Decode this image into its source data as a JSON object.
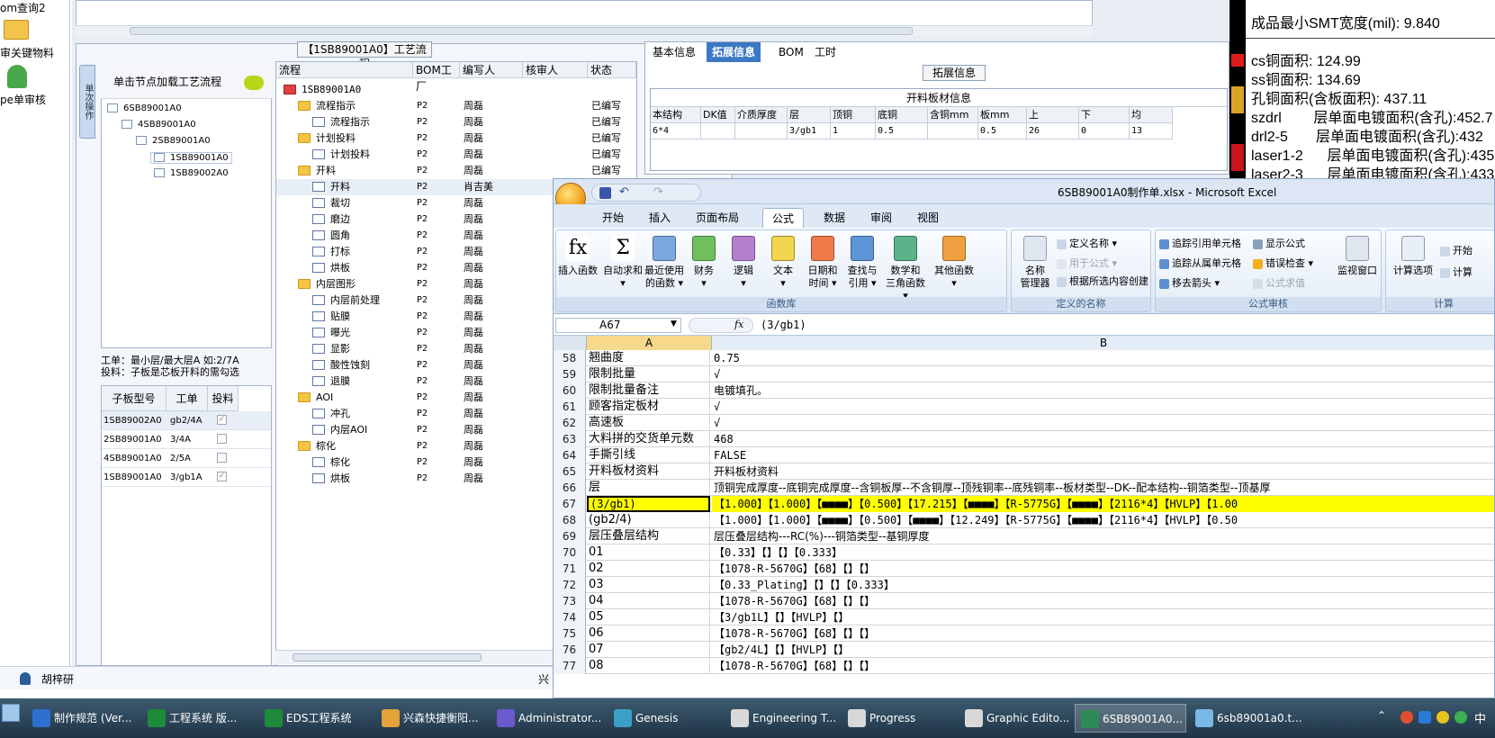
{
  "left_strip": {
    "items": [
      {
        "label": "om查询2",
        "icon": "query-icon"
      },
      {
        "label": "审关键物料",
        "icon": "folder-icon"
      },
      {
        "label": "pe单审核",
        "icon": "user-icon"
      }
    ]
  },
  "user_bar": {
    "name": "胡梓研",
    "status_text": "兴"
  },
  "process_pane": {
    "title": "【1SB89001A0】工艺流程",
    "vertical_tab": "单次操作"
  },
  "tree": {
    "header": "单击节点加载工艺流程",
    "nodes": [
      {
        "label": "6SB89001A0",
        "level": 0
      },
      {
        "label": "4SB89001A0",
        "level": 1
      },
      {
        "label": "2SB89001A0",
        "level": 2
      },
      {
        "label": "1SB89001A0",
        "level": 3
      },
      {
        "label": "1SB89002A0",
        "level": 3
      }
    ]
  },
  "wo_hint": {
    "line1": "工单：最小层/最大层A 如:2/7A",
    "line2": "投料：子板是芯板开料的需勾选"
  },
  "sub_grid": {
    "headers": [
      "子板型号",
      "工单",
      "投料"
    ],
    "rows": [
      {
        "model": "1SB89002A0",
        "wo": "gb2/4A",
        "checked": "✓"
      },
      {
        "model": "2SB89001A0",
        "wo": "3/4A",
        "checked": ""
      },
      {
        "model": "4SB89001A0",
        "wo": "2/5A",
        "checked": ""
      },
      {
        "model": "1SB89001A0",
        "wo": "3/gb1A",
        "checked": "✓"
      }
    ]
  },
  "flow_grid": {
    "headers": [
      "流程",
      "BOM工厂",
      "编写人",
      "核审人",
      "状态"
    ],
    "rows": [
      {
        "name": "1SB89001A0",
        "type": "root",
        "level": 0,
        "factory": "",
        "writer": "",
        "reviewer": "",
        "status": ""
      },
      {
        "name": "流程指示",
        "type": "folder",
        "level": 1,
        "factory": "P2",
        "writer": "周磊",
        "reviewer": "",
        "status": "已编写"
      },
      {
        "name": "流程指示",
        "type": "doc",
        "level": 2,
        "factory": "P2",
        "writer": "周磊",
        "reviewer": "",
        "status": "已编写"
      },
      {
        "name": "计划投料",
        "type": "folder",
        "level": 1,
        "factory": "P2",
        "writer": "周磊",
        "reviewer": "",
        "status": "已编写"
      },
      {
        "name": "计划投料",
        "type": "doc",
        "level": 2,
        "factory": "P2",
        "writer": "周磊",
        "reviewer": "",
        "status": "已编写"
      },
      {
        "name": "开料",
        "type": "folder",
        "level": 1,
        "factory": "P2",
        "writer": "周磊",
        "reviewer": "",
        "status": "已编写"
      },
      {
        "name": "开料",
        "type": "doc",
        "level": 2,
        "factory": "P2",
        "writer": "肖吉美",
        "reviewer": "",
        "status": ""
      },
      {
        "name": "裁切",
        "type": "doc",
        "level": 2,
        "factory": "P2",
        "writer": "周磊",
        "reviewer": "",
        "status": ""
      },
      {
        "name": "磨边",
        "type": "doc",
        "level": 2,
        "factory": "P2",
        "writer": "周磊",
        "reviewer": "",
        "status": ""
      },
      {
        "name": "圆角",
        "type": "doc",
        "level": 2,
        "factory": "P2",
        "writer": "周磊",
        "reviewer": "",
        "status": ""
      },
      {
        "name": "打标",
        "type": "doc",
        "level": 2,
        "factory": "P2",
        "writer": "周磊",
        "reviewer": "",
        "status": ""
      },
      {
        "name": "烘板",
        "type": "doc",
        "level": 2,
        "factory": "P2",
        "writer": "周磊",
        "reviewer": "",
        "status": ""
      },
      {
        "name": "内层图形",
        "type": "folder",
        "level": 1,
        "factory": "P2",
        "writer": "周磊",
        "reviewer": "",
        "status": ""
      },
      {
        "name": "内层前处理",
        "type": "doc",
        "level": 2,
        "factory": "P2",
        "writer": "周磊",
        "reviewer": "",
        "status": ""
      },
      {
        "name": "贴膜",
        "type": "doc",
        "level": 2,
        "factory": "P2",
        "writer": "周磊",
        "reviewer": "",
        "status": ""
      },
      {
        "name": "曝光",
        "type": "doc",
        "level": 2,
        "factory": "P2",
        "writer": "周磊",
        "reviewer": "",
        "status": ""
      },
      {
        "name": "显影",
        "type": "doc",
        "level": 2,
        "factory": "P2",
        "writer": "周磊",
        "reviewer": "",
        "status": ""
      },
      {
        "name": "酸性蚀刻",
        "type": "doc",
        "level": 2,
        "factory": "P2",
        "writer": "周磊",
        "reviewer": "",
        "status": ""
      },
      {
        "name": "退膜",
        "type": "doc",
        "level": 2,
        "factory": "P2",
        "writer": "周磊",
        "reviewer": "",
        "status": ""
      },
      {
        "name": "AOI",
        "type": "folder",
        "level": 1,
        "factory": "P2",
        "writer": "周磊",
        "reviewer": "",
        "status": ""
      },
      {
        "name": "冲孔",
        "type": "doc",
        "level": 2,
        "factory": "P2",
        "writer": "周磊",
        "reviewer": "",
        "status": ""
      },
      {
        "name": "内层AOI",
        "type": "doc",
        "level": 2,
        "factory": "P2",
        "writer": "周磊",
        "reviewer": "",
        "status": ""
      },
      {
        "name": "棕化",
        "type": "folder",
        "level": 1,
        "factory": "P2",
        "writer": "周磊",
        "reviewer": "",
        "status": ""
      },
      {
        "name": "棕化",
        "type": "doc",
        "level": 2,
        "factory": "P2",
        "writer": "周磊",
        "reviewer": "",
        "status": ""
      },
      {
        "name": "烘板",
        "type": "doc",
        "level": 2,
        "factory": "P2",
        "writer": "周磊",
        "reviewer": "",
        "status": ""
      }
    ]
  },
  "info_pane": {
    "tabs": [
      "基本信息",
      "拓展信息",
      "BOM",
      "工时"
    ],
    "active_tab": "拓展信息",
    "section_label": "拓展信息",
    "board_title": "开料板材信息",
    "board_headers": [
      "本结构",
      "DK值",
      "介质厚度",
      "层",
      "顶铜",
      "底铜",
      "含铜mm",
      "板mm",
      "上",
      "下",
      "均"
    ],
    "board_row": [
      "6*4",
      "",
      "",
      "3/gb1",
      "1",
      "0.5",
      "",
      "0.5",
      "26",
      "0",
      "13"
    ]
  },
  "right_info": {
    "lines": [
      "成品最小SMT宽度(mil): 9.840",
      "cs铜面积: 124.99",
      "ss铜面积: 134.69",
      "孔铜面积(含板面积): 437.11",
      "szdrl        层单面电镀面积(含孔):452.7",
      "drl2-5       层单面电镀面积(含孔):432",
      "laser1-2      层单面电镀面积(含孔):435",
      "laser2-3      层单面电镀面积(含孔):433"
    ]
  },
  "excel": {
    "title": "6SB89001A0制作单.xlsx - Microsoft Excel",
    "tabs": [
      "开始",
      "插入",
      "页面布局",
      "公式",
      "数据",
      "审阅",
      "视图"
    ],
    "active_tab": "公式",
    "groups": {
      "function_library": {
        "label": "函数库",
        "buttons": [
          {
            "line1": "插入函数",
            "line2": "",
            "icon": "fx-icon",
            "color": "#ffffff"
          },
          {
            "line1": "自动求和",
            "line2": "▾",
            "icon": "sigma-icon",
            "color": "#ffffff"
          },
          {
            "line1": "最近使用",
            "line2": "的函数 ▾",
            "icon": "star-book-icon",
            "color": "#7aa7dd"
          },
          {
            "line1": "财务",
            "line2": "▾",
            "icon": "finance-book-icon",
            "color": "#6fbf5e"
          },
          {
            "line1": "逻辑",
            "line2": "▾",
            "icon": "logic-book-icon",
            "color": "#b57fd0"
          },
          {
            "line1": "文本",
            "line2": "▾",
            "icon": "text-book-icon",
            "color": "#f1d54c"
          },
          {
            "line1": "日期和",
            "line2": "时间 ▾",
            "icon": "date-book-icon",
            "color": "#f07a4a"
          },
          {
            "line1": "查找与",
            "line2": "引用 ▾",
            "icon": "lookup-book-icon",
            "color": "#5d95d6"
          },
          {
            "line1": "数学和",
            "line2": "三角函数 ▾",
            "icon": "math-book-icon",
            "color": "#5bb389"
          },
          {
            "line1": "其他函数",
            "line2": "▾",
            "icon": "more-book-icon",
            "color": "#f0a040"
          }
        ]
      },
      "defined_names": {
        "label": "定义的名称",
        "manager_line1": "名称",
        "manager_line2": "管理器",
        "define": "定义名称 ▾",
        "use_in_formula": "用于公式 ▾",
        "create_from_selection": "根据所选内容创建"
      },
      "formula_auditing": {
        "label": "公式审核",
        "trace_precedents": "追踪引用单元格",
        "trace_dependents": "追踪从属单元格",
        "remove_arrows": "移去箭头 ▾",
        "show_formulas": "显示公式",
        "error_checking": "错误检查 ▾",
        "evaluate": "公式求值",
        "watch_window": "监视窗口"
      },
      "calculation": {
        "label": "计算",
        "options": "计算选项",
        "calc_now": "开始",
        "calc_sheet": "计算"
      }
    },
    "name_box": "A67",
    "formula": "(3/gb1)",
    "columns": [
      "A",
      "B"
    ],
    "rows": [
      {
        "n": "58",
        "a": "翘曲度",
        "b": "0.75"
      },
      {
        "n": "59",
        "a": "限制批量",
        "b": "√"
      },
      {
        "n": "60",
        "a": "限制批量备注",
        "b": "电镀填孔。"
      },
      {
        "n": "61",
        "a": "顾客指定板材",
        "b": "√"
      },
      {
        "n": "62",
        "a": "高速板",
        "b": "√"
      },
      {
        "n": "63",
        "a": "大料拼的交货单元数",
        "b": "468"
      },
      {
        "n": "64",
        "a": "手撕引线",
        "b": "FALSE"
      },
      {
        "n": "65",
        "a": "开料板材资料",
        "b": "开料板材资料"
      },
      {
        "n": "66",
        "a": "层",
        "b": "顶铜完成厚度--底铜完成厚度--含铜板厚--不含铜厚--顶残铜率--底残铜率--板材类型--DK--配本结构--铜箔类型--顶基厚"
      },
      {
        "n": "67",
        "a": "(3/gb1)",
        "b": "【1.000】【1.000】【■■■■】【0.500】【17.215】【■■■■】【R-5775G】【■■■■】【2116*4】【HVLP】【1.00"
      },
      {
        "n": "68",
        "a": "(gb2/4)",
        "b": "【1.000】【1.000】【■■■■】【0.500】【■■■■】【12.249】【R-5775G】【■■■■】【2116*4】【HVLP】【0.50"
      },
      {
        "n": "69",
        "a": "层压叠层结构",
        "b": "层压叠层结构---RC(%)---铜箔类型--基铜厚度"
      },
      {
        "n": "70",
        "a": "01",
        "b": "【0.33】【】【】【0.333】"
      },
      {
        "n": "71",
        "a": "02",
        "b": "【1078-R-5670G】【68】【】【】"
      },
      {
        "n": "72",
        "a": "03",
        "b": "【0.33_Plating】【】【】【0.333】"
      },
      {
        "n": "73",
        "a": "04",
        "b": "【1078-R-5670G】【68】【】【】"
      },
      {
        "n": "74",
        "a": "05",
        "b": "【3/gb1L】【】【HVLP】【】"
      },
      {
        "n": "75",
        "a": "06",
        "b": "【1078-R-5670G】【68】【】【】"
      },
      {
        "n": "76",
        "a": "07",
        "b": "【gb2/4L】【】【HVLP】【】"
      },
      {
        "n": "77",
        "a": "08",
        "b": "【1078-R-5670G】【68】【】【】"
      }
    ]
  },
  "taskbar": {
    "items": [
      {
        "label": "制作规范 (Ver...",
        "icon": "doc-icon",
        "color": "#2f6fd0"
      },
      {
        "label": "工程系统  版...",
        "icon": "app-p-icon",
        "color": "#1f8a3a"
      },
      {
        "label": "EDS工程系统",
        "icon": "app-e-icon",
        "color": "#1f8a3a"
      },
      {
        "label": "兴森快捷衡阳...",
        "icon": "cake-icon",
        "color": "#e3a23a"
      },
      {
        "label": "Administrator...",
        "icon": "save-icon",
        "color": "#6a5acd"
      },
      {
        "label": "Genesis",
        "icon": "genesis-icon",
        "color": "#3aa0c8"
      },
      {
        "label": "Engineering T...",
        "icon": "x-window-icon",
        "color": "#d8d8d8"
      },
      {
        "label": "Progress",
        "icon": "x-window-icon",
        "color": "#d8d8d8"
      },
      {
        "label": "Graphic Edito...",
        "icon": "x-window-icon",
        "color": "#d8d8d8"
      },
      {
        "label": "6SB89001A0...",
        "icon": "excel-icon",
        "color": "#2e8b57"
      },
      {
        "label": "6sb89001a0.t...",
        "icon": "notepad-icon",
        "color": "#7ab8e6"
      }
    ],
    "tray_text": "中"
  }
}
